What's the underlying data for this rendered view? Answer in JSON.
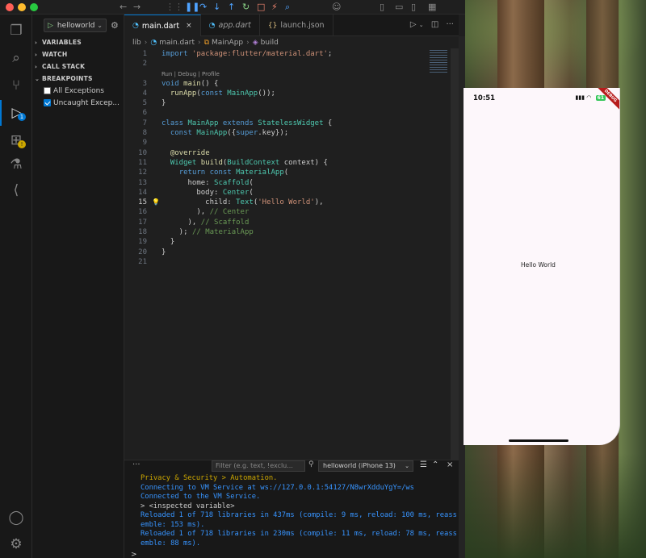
{
  "activity_bar": {
    "items": [
      {
        "name": "explorer",
        "icon": "files-icon"
      },
      {
        "name": "search",
        "icon": "search-icon"
      },
      {
        "name": "source-control",
        "icon": "source-control-icon"
      },
      {
        "name": "run-and-debug",
        "icon": "debug-icon",
        "badge": "1"
      },
      {
        "name": "extensions",
        "icon": "extensions-icon",
        "badge": "!"
      },
      {
        "name": "testing",
        "icon": "flask-icon"
      },
      {
        "name": "flutter",
        "icon": "flutter-icon"
      }
    ],
    "bottom": [
      {
        "icon": "account-icon"
      },
      {
        "icon": "manage-gear-icon"
      }
    ]
  },
  "run_config": {
    "name": "helloworld"
  },
  "sidebar": {
    "sections": [
      "VARIABLES",
      "WATCH",
      "CALL STACK",
      "BREAKPOINTS"
    ],
    "breakpoints": [
      {
        "label": "All Exceptions",
        "checked": false
      },
      {
        "label": "Uncaught Excep...",
        "checked": true
      }
    ]
  },
  "tabs": [
    {
      "label": "main.dart",
      "active": true,
      "close": "×"
    },
    {
      "label": "app.dart",
      "active": false
    },
    {
      "label": "launch.json",
      "active": false
    }
  ],
  "breadcrumb": {
    "parts": [
      "lib",
      "main.dart",
      "MainApp",
      "build"
    ]
  },
  "code": {
    "codelens": "Run | Debug | Profile",
    "lines": [
      {
        "n": "1",
        "text": "import 'package:flutter/material.dart';"
      },
      {
        "n": "2",
        "text": ""
      },
      {
        "n": "3",
        "text": "void main() {"
      },
      {
        "n": "4",
        "text": "  runApp(const MainApp());"
      },
      {
        "n": "5",
        "text": "}"
      },
      {
        "n": "6",
        "text": ""
      },
      {
        "n": "7",
        "text": "class MainApp extends StatelessWidget {"
      },
      {
        "n": "8",
        "text": "  const MainApp({super.key});"
      },
      {
        "n": "9",
        "text": ""
      },
      {
        "n": "10",
        "text": "  @override"
      },
      {
        "n": "11",
        "text": "  Widget build(BuildContext context) {"
      },
      {
        "n": "12",
        "text": "    return const MaterialApp("
      },
      {
        "n": "13",
        "text": "      home: Scaffold("
      },
      {
        "n": "14",
        "text": "        body: Center("
      },
      {
        "n": "15",
        "text": "          child: Text('Hello World'),"
      },
      {
        "n": "16",
        "text": "        ), // Center"
      },
      {
        "n": "17",
        "text": "      ), // Scaffold"
      },
      {
        "n": "18",
        "text": "    ); // MaterialApp"
      },
      {
        "n": "19",
        "text": "  }"
      },
      {
        "n": "20",
        "text": "}"
      },
      {
        "n": "21",
        "text": ""
      }
    ]
  },
  "panel": {
    "filter_placeholder": "Filter (e.g. text, !exclu...",
    "session": "helloworld (iPhone 13)",
    "console": [
      {
        "kind": "warn",
        "text": "Privacy & Security > Automation."
      },
      {
        "kind": "info",
        "text": "Connecting to VM Service at ws://127.0.0.1:54127/N8wrXdduYgY=/ws"
      },
      {
        "kind": "info",
        "text": "Connected to the VM Service."
      },
      {
        "kind": "plain",
        "text": "> <inspected variable>"
      },
      {
        "kind": "info",
        "text": "Reloaded 1 of 718 libraries in 437ms (compile: 9 ms, reload: 100 ms, reassemble: 153 ms)."
      },
      {
        "kind": "info",
        "text": "Reloaded 1 of 718 libraries in 230ms (compile: 11 ms, reload: 78 ms, reassemble: 88 ms)."
      }
    ],
    "prompt": ">"
  },
  "simulator": {
    "time": "10:51",
    "battery": "61",
    "debug_banner": "DEBUG",
    "hello_text": "Hello World"
  }
}
